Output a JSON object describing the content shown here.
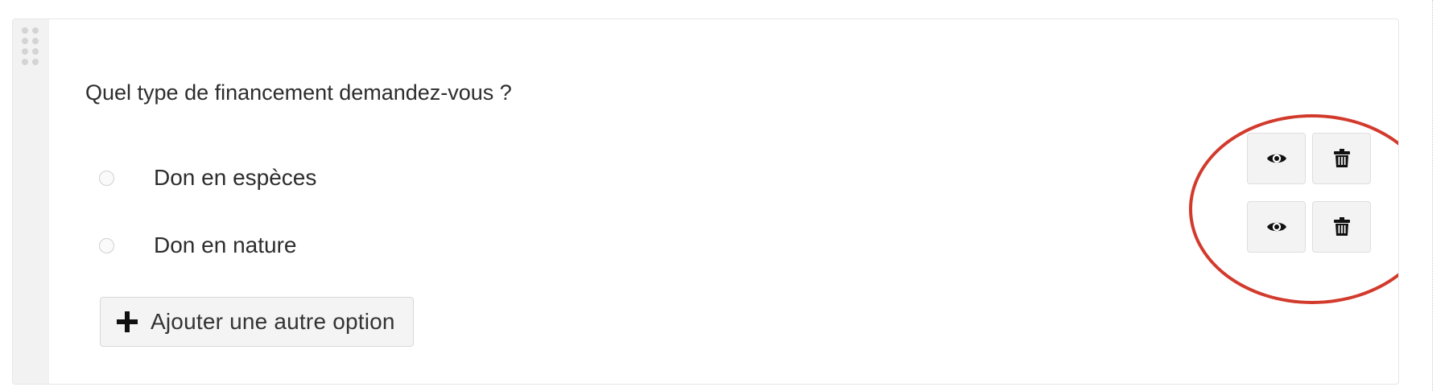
{
  "question": {
    "text": "Quel type de financement demandez-vous ?"
  },
  "options": [
    {
      "label": "Don en espèces",
      "selected": false,
      "actions": {
        "visibility_icon": "eye-icon",
        "delete_icon": "trash-icon"
      }
    },
    {
      "label": "Don en nature",
      "selected": false,
      "actions": {
        "visibility_icon": "eye-icon",
        "delete_icon": "trash-icon"
      }
    }
  ],
  "add_option": {
    "icon": "plus-icon",
    "label": "Ajouter une autre option"
  },
  "drag_handle": {
    "icon": "drag-dots-icon"
  },
  "annotation": {
    "shape": "ellipse",
    "color": "#d23a2c"
  },
  "colors": {
    "text": "#2d2d2d",
    "handle_bg": "#f2f2f2",
    "button_bg": "#f3f3f3",
    "annotation": "#d23a2c"
  }
}
